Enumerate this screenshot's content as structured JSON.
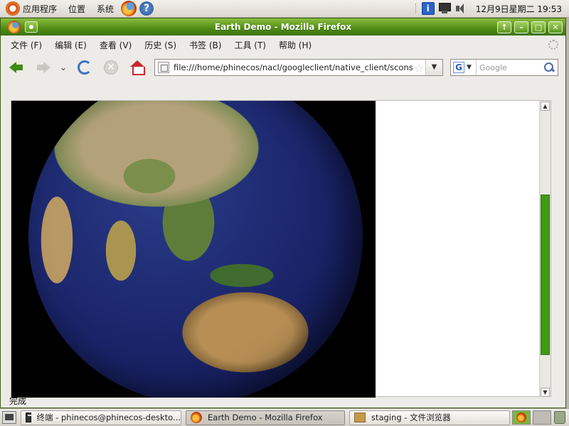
{
  "top_panel": {
    "menus": [
      "应用程序",
      "位置",
      "系统"
    ],
    "clock": "12月9日星期二 19:53"
  },
  "window": {
    "title": "Earth Demo - Mozilla Firefox",
    "menubar": [
      "文件 (F)",
      "编辑 (E)",
      "查看 (V)",
      "历史 (S)",
      "书签 (B)",
      "工具 (T)",
      "帮助 (H)"
    ],
    "url": "file:///home/phinecos/nacl/googleclient/native_client/scons-o",
    "search": {
      "engine": "Google",
      "placeholder": "Google"
    },
    "status": "完成"
  },
  "icons": {
    "back": "back-arrow-icon",
    "forward": "forward-arrow-icon",
    "reload": "reload-icon",
    "stop": "stop-icon",
    "home": "home-icon",
    "bookmark_star": "star-icon",
    "search": "magnifier-icon"
  },
  "taskbar": {
    "tasks": [
      "终端 - phinecos@phinecos-deskto...",
      "Earth Demo - Mozilla Firefox",
      "staging - 文件浏览器"
    ]
  },
  "colors": {
    "titlebar_green": "#4f8a14",
    "scroll_thumb": "#3f9a14"
  }
}
